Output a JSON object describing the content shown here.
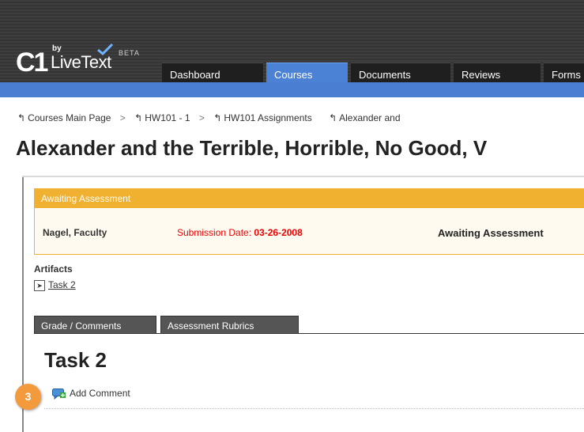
{
  "logo": {
    "by": "by",
    "brand": "LiveText",
    "prefix": "C1",
    "beta": "BETA"
  },
  "nav": {
    "tabs": [
      {
        "label": "Dashboard",
        "active": false
      },
      {
        "label": "Courses",
        "active": true
      },
      {
        "label": "Documents",
        "active": false
      },
      {
        "label": "Reviews",
        "active": false
      },
      {
        "label": "Forms",
        "active": false
      }
    ]
  },
  "breadcrumb": {
    "items": [
      "Courses Main Page",
      "HW101 - 1",
      "HW101 Assignments",
      "Alexander and"
    ],
    "separator": ">"
  },
  "page": {
    "title": "Alexander and the Terrible, Horrible, No Good, V"
  },
  "status": {
    "header": "Awaiting Assessment",
    "faculty": "Nagel, Faculty",
    "submission_label": "Submission Date:",
    "submission_date": "03-26-2008",
    "state": "Awaiting Assessment"
  },
  "artifacts": {
    "label": "Artifacts",
    "items": [
      "Task 2"
    ]
  },
  "tabs": {
    "grade_comments": "Grade / Comments",
    "assessment_rubrics": "Assessment Rubrics"
  },
  "task": {
    "title": "Task 2",
    "add_comment": "Add Comment"
  },
  "callout": {
    "number": "3",
    "color": "#f39b3c"
  },
  "colors": {
    "accent_blue": "#4a7ed3",
    "status_orange": "#f0b030",
    "date_red": "#ee0000"
  }
}
